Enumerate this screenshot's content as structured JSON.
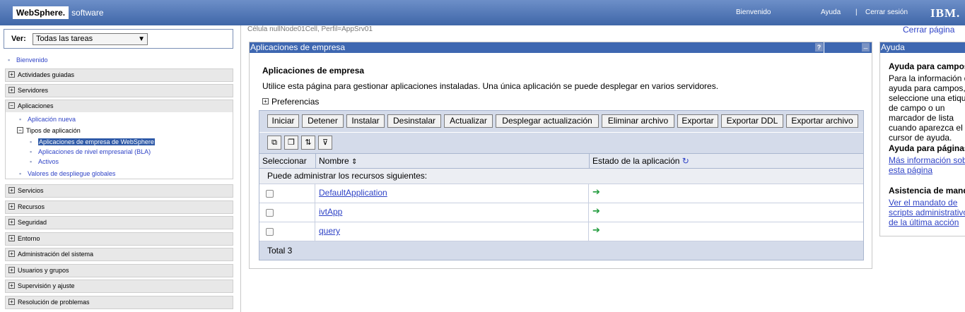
{
  "banner": {
    "brand_name": "WebSphere.",
    "brand_suffix": "software",
    "welcome": "Bienvenido",
    "help": "Ayuda",
    "separator": "|",
    "logout": "Cerrar sesión",
    "vendor_logo": "IBM."
  },
  "nav": {
    "view_label": "Ver:",
    "view_selected": "Todas las tareas",
    "welcome": "Bienvenido",
    "categories_top": [
      {
        "label": "Actividades guiadas",
        "expander": "+"
      },
      {
        "label": "Servidores",
        "expander": "+"
      }
    ],
    "applications": {
      "label": "Aplicaciones",
      "expander": "−",
      "new_app": "Aplicación nueva",
      "types_label": "Tipos de aplicación",
      "types_expander": "−",
      "types": [
        "Aplicaciones de empresa de WebSphere",
        "Aplicaciones de nivel empresarial (BLA)",
        "Activos"
      ],
      "global_values": "Valores de despliegue globales"
    },
    "categories_bottom": [
      {
        "label": "Servicios",
        "expander": "+"
      },
      {
        "label": "Recursos",
        "expander": "+"
      },
      {
        "label": "Seguridad",
        "expander": "+"
      },
      {
        "label": "Entorno",
        "expander": "+"
      },
      {
        "label": "Administración del sistema",
        "expander": "+"
      },
      {
        "label": "Usuarios y grupos",
        "expander": "+"
      },
      {
        "label": "Supervisión y ajuste",
        "expander": "+"
      },
      {
        "label": "Resolución de problemas",
        "expander": "+"
      }
    ]
  },
  "main": {
    "breadcrumb": "Célula nullNode01Cell, Perfil=AppSrv01",
    "logout_page": "Cerrar página",
    "portlet_title": "Aplicaciones de empresa",
    "portlet_help": "?",
    "portlet_minimize": "_",
    "page_title": "Aplicaciones de empresa",
    "description": "Utilice esta página para gestionar aplicaciones instaladas. Una única aplicación se puede desplegar en varios servidores.",
    "preferences": "Preferencias",
    "buttons": {
      "start": "Iniciar",
      "stop": "Detener",
      "install": "Instalar",
      "uninstall": "Desinstalar",
      "update": "Actualizar",
      "rollout": "Desplegar actualización",
      "remove_file": "Eliminar archivo",
      "export": "Exportar",
      "export_ddl": "Exportar DDL",
      "export_file": "Exportar archivo"
    },
    "table": {
      "col_select": "Seleccionar",
      "col_name": "Nombre",
      "col_state": "Estado de la aplicación",
      "resources_note": "Puede administrar los recursos siguientes:",
      "rows": [
        {
          "name": "DefaultApplication",
          "state_icon": "started-arrow-icon"
        },
        {
          "name": "ivtApp",
          "state_icon": "started-arrow-icon"
        },
        {
          "name": "query",
          "state_icon": "started-arrow-icon"
        }
      ],
      "total": "Total 3"
    }
  },
  "help": {
    "title": "Ayuda",
    "field_help_heading": "Ayuda para campos",
    "field_help_text": "Para la información de ayuda para campos, seleccione una etiqueta de campo o un marcador de lista cuando aparezca el cursor de ayuda.",
    "page_help_heading": "Ayuda para páginas",
    "page_help_link": "Más información sobre esta página",
    "command_heading": "Asistencia de mandatos",
    "command_link": "Ver el mandato de scripts administrativos de la última acción"
  },
  "colors": {
    "banner": "#3f66a8",
    "portlet_header": "#3e67b1",
    "link": "#2f43c6",
    "toolbar": "#d4dbea",
    "started": "#1e9a3a"
  }
}
